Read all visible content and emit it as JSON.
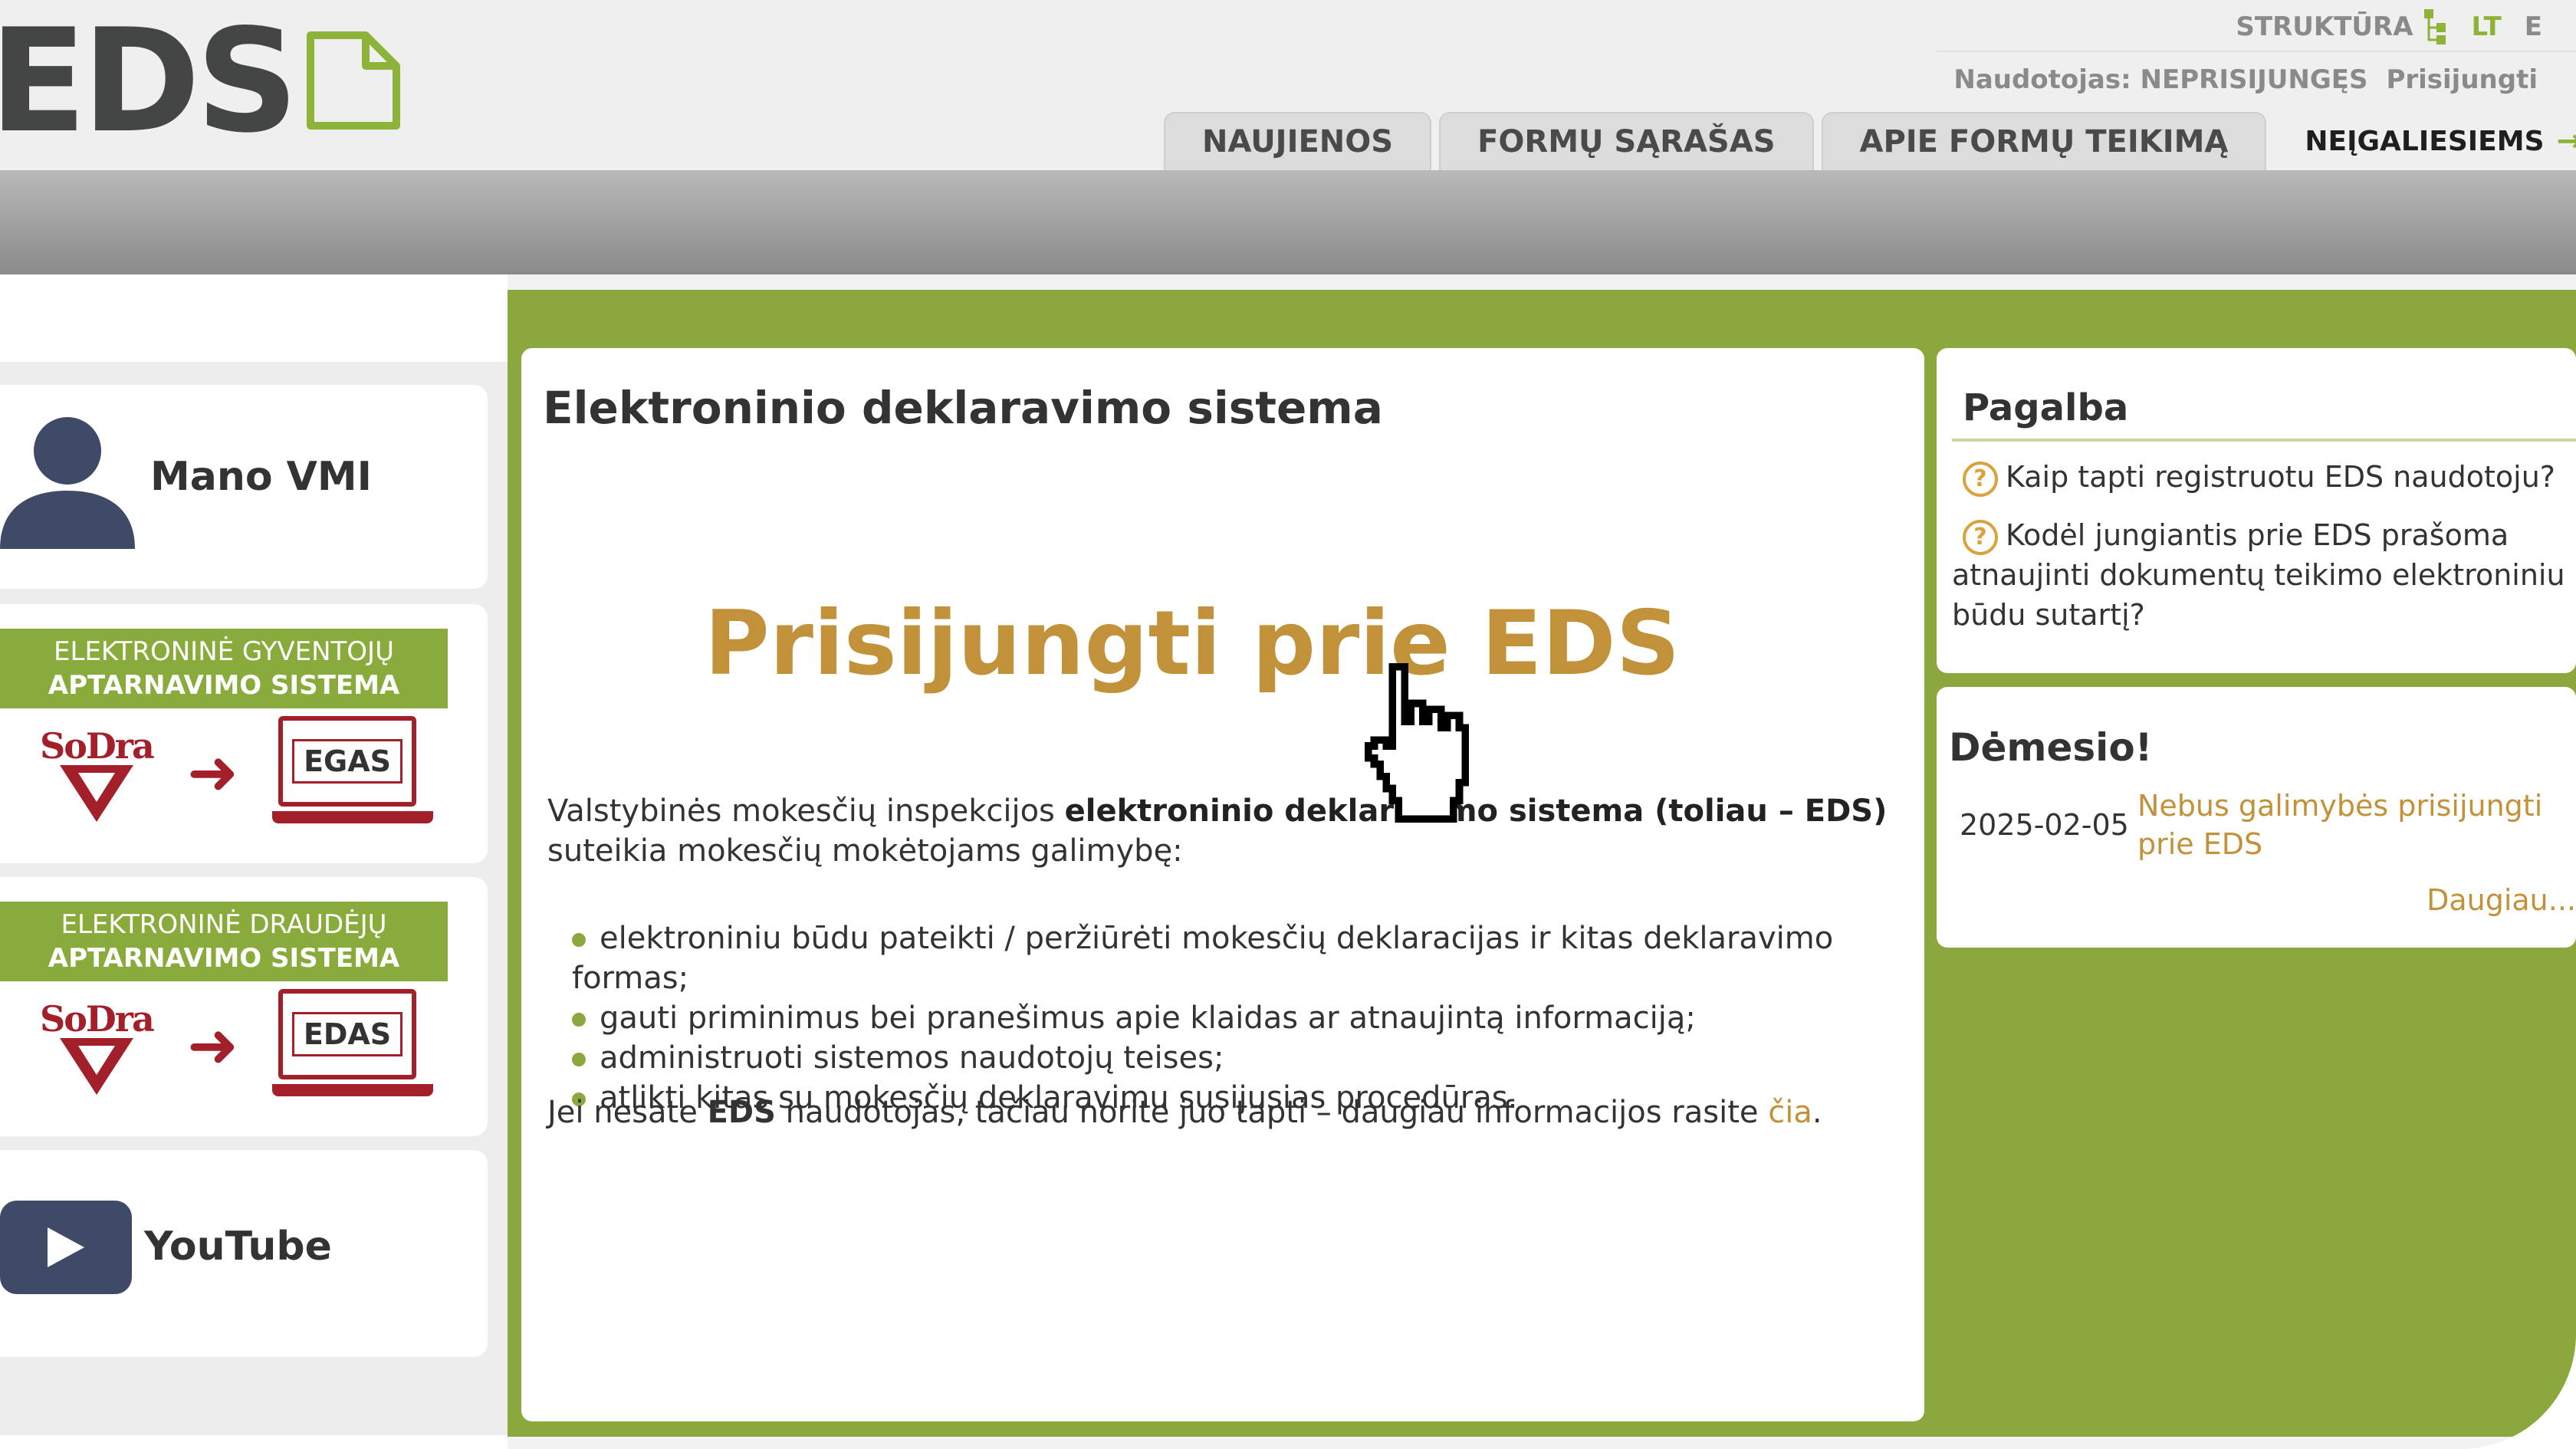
{
  "header": {
    "logo_text": "EDS",
    "structure_label": "STRUKTŪRA",
    "lang_lt": "LT",
    "lang_other": "E",
    "user_label": "Naudotojas: NEPRISIJUNGĘS",
    "login_label": "Prisijungti",
    "nav_tabs": [
      "NAUJIENOS",
      "FORMŲ SĄRAŠAS",
      "APIE FORMŲ TEIKIMĄ"
    ],
    "nav_disabled": "NEĮGALIESIEMS"
  },
  "left": {
    "manovmi": "Mano VMI",
    "egas": {
      "line1": "ELEKTRONINĖ GYVENTOJŲ",
      "line2": "APTARNAVIMO SISTEMA",
      "logo": "SoDra",
      "screen": "EGAS"
    },
    "edas": {
      "line1": "ELEKTRONINĖ DRAUDĖJŲ",
      "line2": "APTARNAVIMO SISTEMA",
      "logo": "SoDra",
      "screen": "EDAS"
    },
    "youtube": "YouTube"
  },
  "main": {
    "title": "Elektroninio deklaravimo sistema",
    "login_link": "Prisijungti prie EDS",
    "intro_part1": "Valstybinės mokesčių inspekcijos ",
    "intro_bold": "elektroninio deklaravimo sistema (toliau – EDS)",
    "intro_part2": " suteikia mokesčių mokėtojams galimybę:",
    "bullets": [
      "elektroniniu būdu pateikti / peržiūrėti mokesčių deklaracijas ir kitas deklaravimo formas;",
      "gauti priminimus bei pranešimus apie klaidas ar atnaujintą informaciją;",
      "administruoti sistemos naudotojų teises;",
      "atlikti kitas su mokesčių deklaravimu susijusias procedūras."
    ],
    "note_part1": "Jei nesate ",
    "note_bold": "EDS",
    "note_part2": " naudotojas, tačiau norite juo tapti – daugiau informacijos rasite ",
    "note_link": "čia",
    "note_end": "."
  },
  "help": {
    "title": "Pagalba",
    "q1": "Kaip tapti registruotu EDS naudotoju?",
    "q2": "Kodėl jungiantis prie EDS prašoma atnaujinti dokumentų teikimo elektroniniu būdu sutartį?"
  },
  "attention": {
    "title": "Dėmesio!",
    "date": "2025-02-05",
    "text": "Nebus galimybės prisijungti prie EDS",
    "more": "Daugiau..."
  },
  "colors": {
    "accent_green": "#8aa83e",
    "link_gold": "#c1923a",
    "sodra_red": "#a31f2a"
  },
  "icons": [
    "structure-icon",
    "arrow-right-icon",
    "user-icon",
    "youtube-play-icon",
    "help-question-icon",
    "hand-pointer-cursor-icon"
  ]
}
